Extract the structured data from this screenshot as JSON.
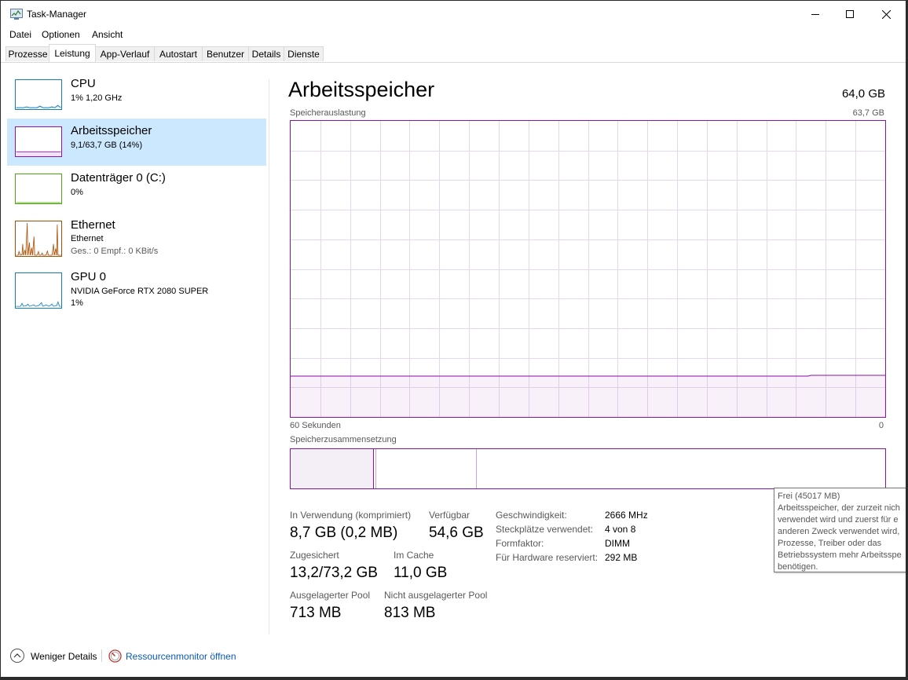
{
  "window": {
    "title": "Task-Manager"
  },
  "menu": [
    "Datei",
    "Optionen",
    "Ansicht"
  ],
  "tabs": [
    "Prozesse",
    "Leistung",
    "App-Verlauf",
    "Autostart",
    "Benutzer",
    "Details",
    "Dienste"
  ],
  "active_tab": "Leistung",
  "sidebar": {
    "items": [
      {
        "name": "CPU",
        "line1": "1%  1,20 GHz",
        "line2": "",
        "color": "#117dbb"
      },
      {
        "name": "Arbeitsspeicher",
        "line1": "9,1/63,7 GB (14%)",
        "line2": "",
        "color": "#8b12ae",
        "selected": true
      },
      {
        "name": "Datenträger 0 (C:)",
        "line1": "0%",
        "line2": "",
        "color": "#4da60c"
      },
      {
        "name": "Ethernet",
        "line1": "Ethernet",
        "line2": "Ges.: 0 Empf.: 0 KBit/s",
        "color": "#a74f01"
      },
      {
        "name": "GPU 0",
        "line1": "NVIDIA GeForce RTX 2080 SUPER",
        "line2": "1%",
        "color": "#117dbb"
      }
    ]
  },
  "main": {
    "title": "Arbeitsspeicher",
    "total": "64,0 GB",
    "usage_label": "Speicherauslastung",
    "usage_max": "63,7 GB",
    "time_left": "60 Sekunden",
    "time_right": "0",
    "usage_fraction": 0.14,
    "composition_label": "Speicherzusammensetzung",
    "stats": {
      "in_use_label": "In Verwendung (komprimiert)",
      "in_use_value": "8,7 GB (0,2 MB)",
      "available_label": "Verfügbar",
      "available_value": "54,6 GB",
      "committed_label": "Zugesichert",
      "committed_value": "13,2/73,2 GB",
      "cached_label": "Im Cache",
      "cached_value": "11,0 GB",
      "paged_label": "Ausgelagerter Pool",
      "paged_value": "713 MB",
      "nonpaged_label": "Nicht ausgelagerter Pool",
      "nonpaged_value": "813 MB"
    },
    "details": [
      {
        "label": "Geschwindigkeit:",
        "value": "2666 MHz"
      },
      {
        "label": "Steckplätze verwendet:",
        "value": "4 von 8"
      },
      {
        "label": "Formfaktor:",
        "value": "DIMM"
      },
      {
        "label": "Für Hardware reserviert:",
        "value": "292 MB"
      }
    ]
  },
  "tooltip": {
    "title": "Frei (45017 MB)",
    "lines": [
      "Arbeitsspeicher, der zurzeit nich",
      "verwendet wird und zuerst für e",
      "anderen Zweck verwendet wird,",
      "Prozesse, Treiber oder das",
      "Betriebssystem mehr Arbeitsspe",
      "benötigen."
    ]
  },
  "footer": {
    "fewer_details": "Weniger Details",
    "resource_monitor": "Ressourcenmonitor öffnen"
  }
}
